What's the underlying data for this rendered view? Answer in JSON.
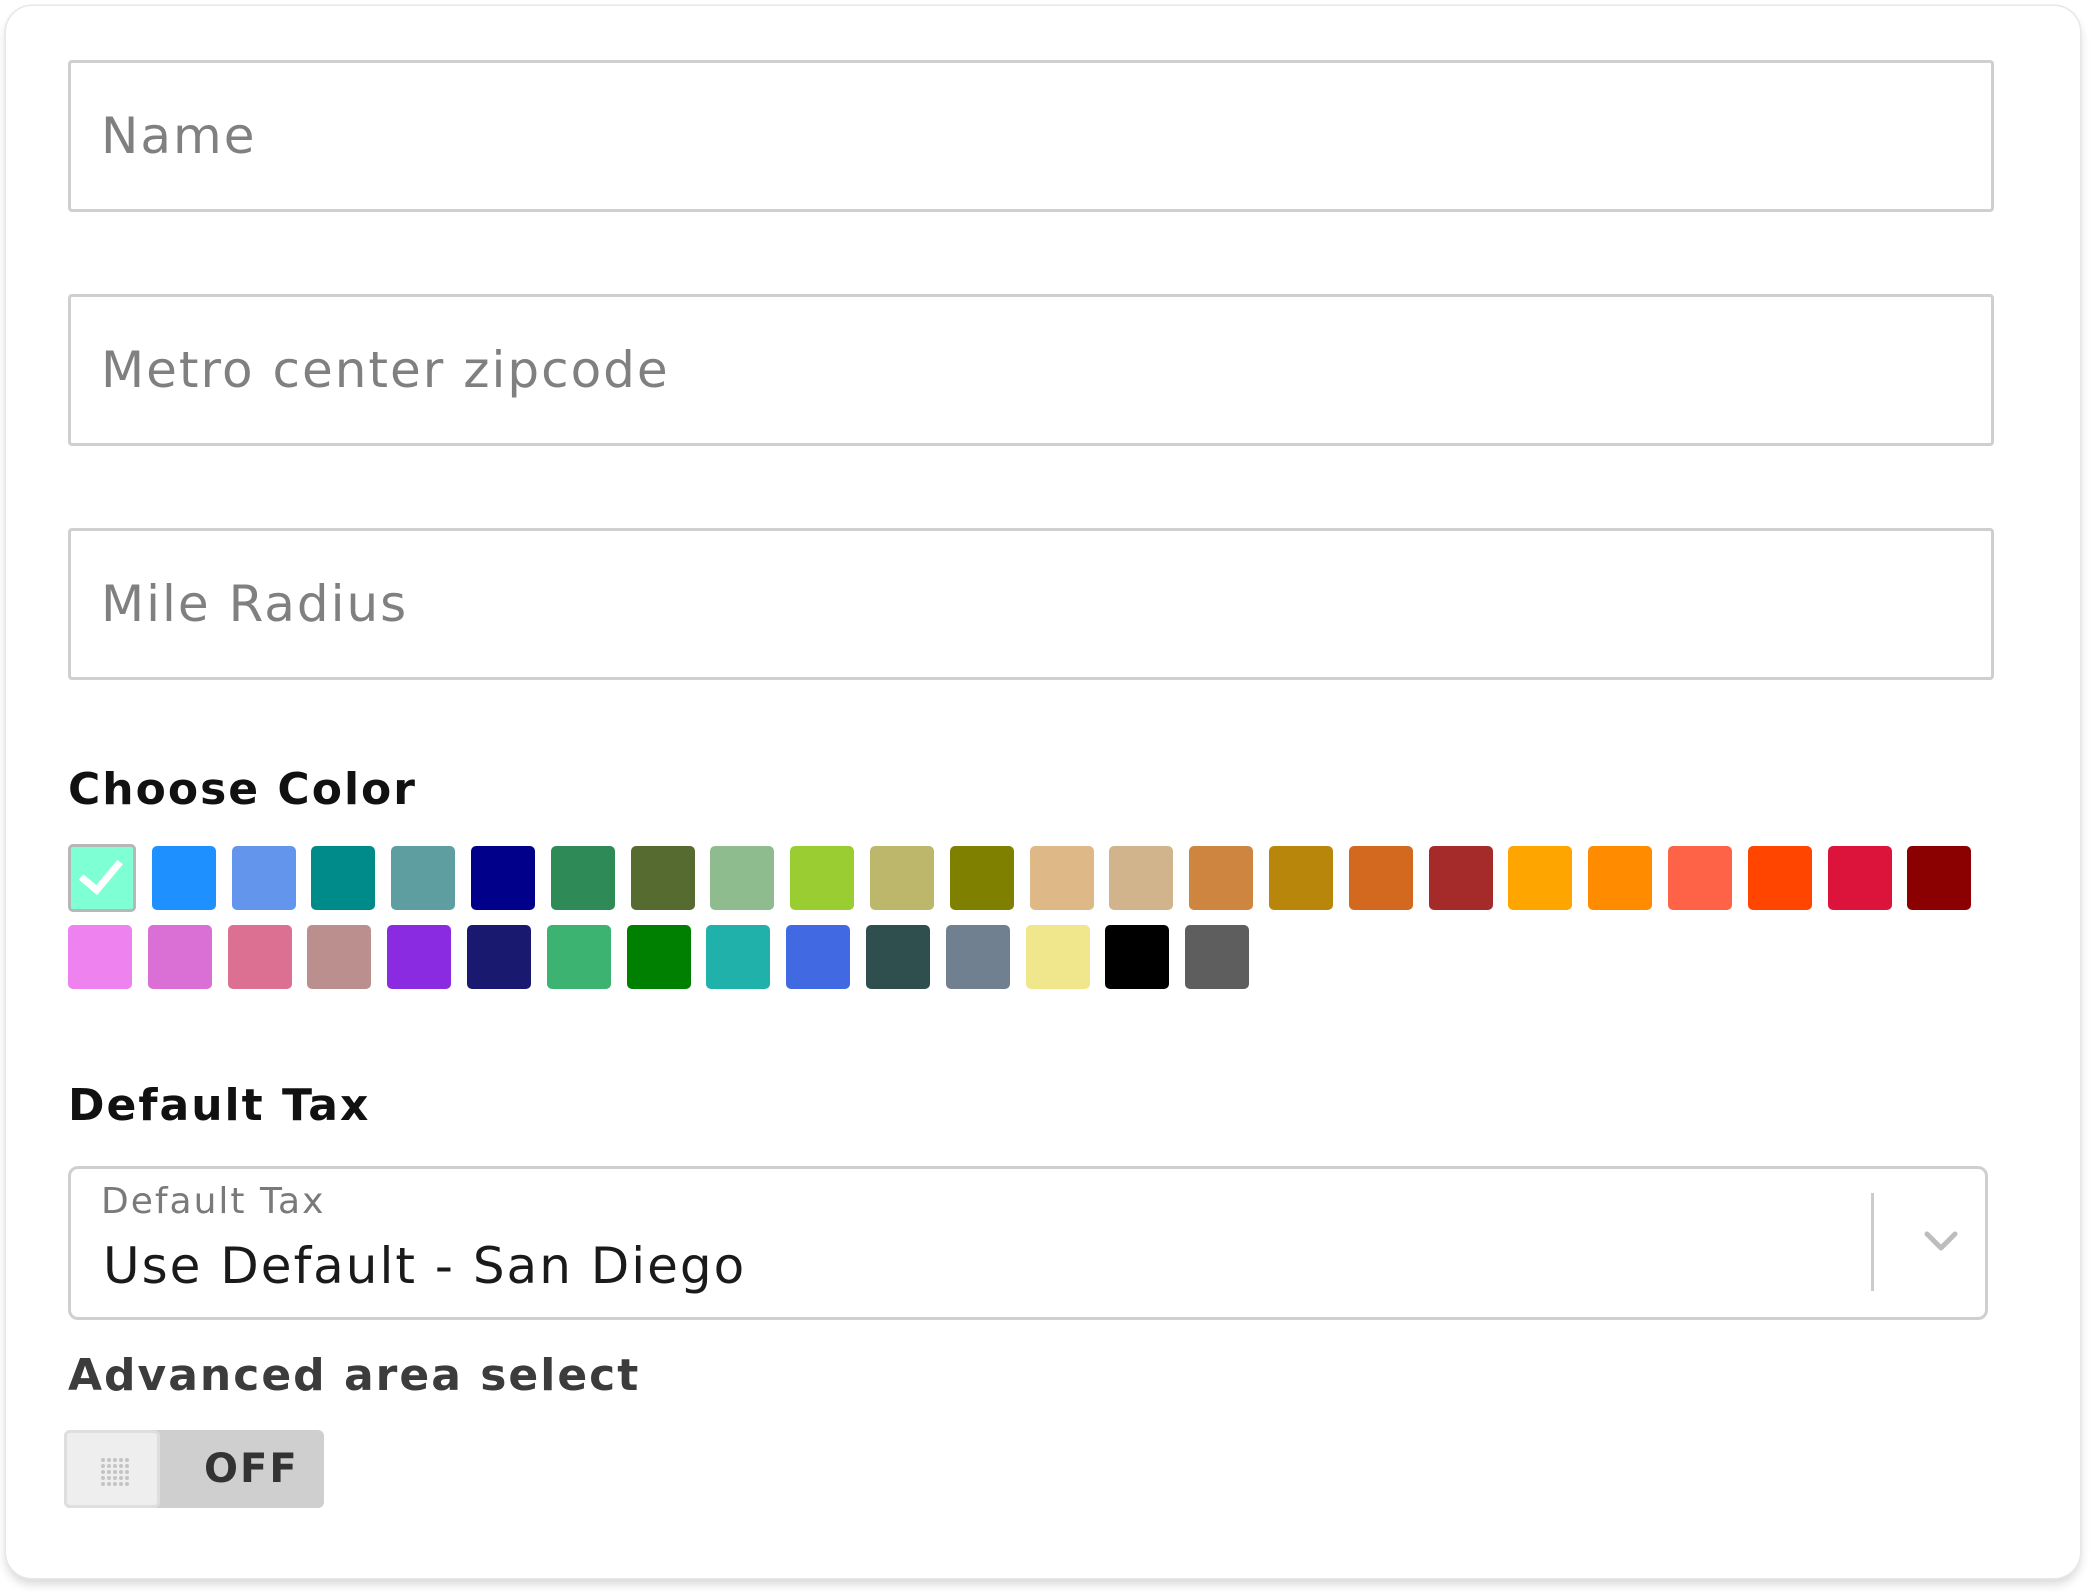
{
  "form": {
    "name_placeholder": "Name",
    "name_value": "",
    "zipcode_placeholder": "Metro center zipcode",
    "zipcode_value": "",
    "radius_placeholder": "Mile Radius",
    "radius_value": ""
  },
  "color_section": {
    "label": "Choose Color",
    "selected_index": 0,
    "swatches": [
      {
        "name": "aquamarine",
        "hex": "#7FFFD4"
      },
      {
        "name": "dodgerblue",
        "hex": "#1E90FF"
      },
      {
        "name": "cornflowerblue",
        "hex": "#6495ED"
      },
      {
        "name": "darkcyan",
        "hex": "#008B8B"
      },
      {
        "name": "cadetblue",
        "hex": "#5F9EA0"
      },
      {
        "name": "darkblue",
        "hex": "#00008B"
      },
      {
        "name": "seagreen",
        "hex": "#2E8B57"
      },
      {
        "name": "darkolivegreen",
        "hex": "#556B2F"
      },
      {
        "name": "darkseagreen",
        "hex": "#8FBC8F"
      },
      {
        "name": "yellowgreen",
        "hex": "#9ACD32"
      },
      {
        "name": "darkkhaki",
        "hex": "#BDB76B"
      },
      {
        "name": "olive",
        "hex": "#808000"
      },
      {
        "name": "burlywood",
        "hex": "#DEB887"
      },
      {
        "name": "tan",
        "hex": "#D2B48C"
      },
      {
        "name": "peru",
        "hex": "#CD853F"
      },
      {
        "name": "darkgoldenrod",
        "hex": "#B8860B"
      },
      {
        "name": "chocolate",
        "hex": "#D2691E"
      },
      {
        "name": "brown",
        "hex": "#A52A2A"
      },
      {
        "name": "orange",
        "hex": "#FFA500"
      },
      {
        "name": "darkorange",
        "hex": "#FF8C00"
      },
      {
        "name": "tomato",
        "hex": "#FF6347"
      },
      {
        "name": "orangered",
        "hex": "#FF4500"
      },
      {
        "name": "crimson",
        "hex": "#DC143C"
      },
      {
        "name": "darkred",
        "hex": "#8B0000"
      },
      {
        "name": "violet",
        "hex": "#EE82EE"
      },
      {
        "name": "orchid",
        "hex": "#DA70D6"
      },
      {
        "name": "palevioletred",
        "hex": "#DB7093"
      },
      {
        "name": "rosybrown",
        "hex": "#BC8F8F"
      },
      {
        "name": "blueviolet",
        "hex": "#8A2BE2"
      },
      {
        "name": "midnightblue",
        "hex": "#191970"
      },
      {
        "name": "mediumseagreen",
        "hex": "#3CB371"
      },
      {
        "name": "green",
        "hex": "#008000"
      },
      {
        "name": "lightseagreen",
        "hex": "#20B2AA"
      },
      {
        "name": "royalblue",
        "hex": "#4169E1"
      },
      {
        "name": "darkslategray",
        "hex": "#2F4F4F"
      },
      {
        "name": "slategray",
        "hex": "#708090"
      },
      {
        "name": "khaki",
        "hex": "#F0E68C"
      },
      {
        "name": "black",
        "hex": "#000000"
      },
      {
        "name": "dimgray",
        "hex": "#5E5E5E"
      }
    ]
  },
  "tax_section": {
    "label": "Default Tax",
    "select_caption": "Default Tax",
    "select_value": "Use Default - San Diego",
    "dropdown_icon": "chevron-down-icon"
  },
  "advanced_section": {
    "label": "Advanced area select",
    "toggle_state": "OFF",
    "handle_icon": "grip-dots-icon"
  },
  "colors": {
    "input_border": "#cfcfcf",
    "placeholder": "#808080",
    "toggle_off_bg": "#cfcfcf"
  }
}
